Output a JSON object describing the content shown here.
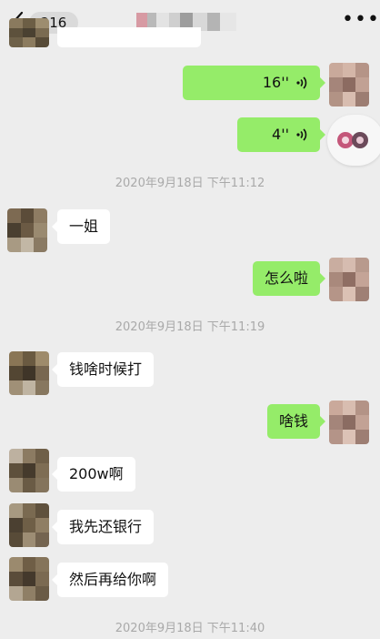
{
  "header": {
    "back_label": "back",
    "unread_count": "216",
    "more_label": "•••"
  },
  "messages": {
    "voice_1": "16''",
    "voice_2": "4''",
    "timestamp_1": "2020年9月18日 下午11:12",
    "msg_1": "一姐",
    "msg_2": "怎么啦",
    "timestamp_2": "2020年9月18日 下午11:19",
    "msg_3": "钱啥时候打",
    "msg_4": "啥钱",
    "msg_5": "200w啊",
    "msg_6": "我先还银行",
    "msg_7": "然后再给你啊",
    "timestamp_3": "2020年9月18日 下午11:40"
  },
  "colors": {
    "background": "#ededed",
    "bubble_self": "#95ec69",
    "bubble_other": "#ffffff",
    "timestamp": "#a9a9a9"
  },
  "icons": [
    "chevron-left-icon",
    "more-icon",
    "voice-wave-icon"
  ]
}
